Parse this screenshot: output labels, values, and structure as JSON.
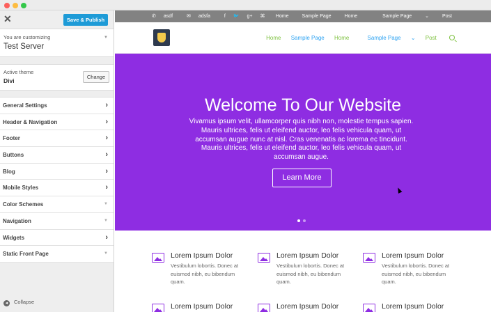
{
  "customizer": {
    "close_icon": "close-icon",
    "publish_label": "Save & Publish",
    "customizing_label": "You are customizing",
    "site_name": "Test Server",
    "active_theme_label": "Active theme",
    "theme_name": "Divi",
    "change_label": "Change",
    "sections": [
      {
        "label": "General Settings",
        "icon": "chevron-right-icon"
      },
      {
        "label": "Header & Navigation",
        "icon": "chevron-right-icon"
      },
      {
        "label": "Footer",
        "icon": "chevron-right-icon"
      },
      {
        "label": "Buttons",
        "icon": "chevron-right-icon"
      },
      {
        "label": "Blog",
        "icon": "chevron-right-icon"
      },
      {
        "label": "Mobile Styles",
        "icon": "chevron-right-icon"
      },
      {
        "label": "Color Schemes",
        "icon": "caret-down-icon"
      },
      {
        "label": "Navigation",
        "icon": "caret-down-icon"
      },
      {
        "label": "Widgets",
        "icon": "chevron-right-icon"
      },
      {
        "label": "Static Front Page",
        "icon": "caret-down-icon"
      }
    ],
    "collapse_label": "Collapse"
  },
  "site": {
    "topbar": {
      "phone": "asdf",
      "email": "adsfa",
      "social_icons": [
        "facebook-icon",
        "twitter-icon",
        "google-plus-icon",
        "rss-icon"
      ],
      "links": [
        "Home",
        "Sample Page",
        "Home",
        "Sample Page",
        "Post"
      ]
    },
    "nav": [
      "Home",
      "Sample Page",
      "Home",
      "Sample Page",
      "Post"
    ],
    "hero": {
      "title": "Welcome To Our Website",
      "text": "Vivamus ipsum velit, ullamcorper quis nibh non, molestie tempus sapien. Mauris ultrices, felis ut eleifend auctor, leo felis vehicula quam, ut accumsan augue nunc at nisl. Cras venenatis ac lorema ec tincidunt. Mauris ultrices, felis ut eleifend auctor, leo felis vehicula quam, ut accumsan augue.",
      "button": "Learn More",
      "background": "#8e2de2"
    },
    "features": [
      {
        "title": "Lorem Ipsum Dolor",
        "text": "Vestibulum lobortis. Donec at euismod nibh, eu bibendum quam."
      },
      {
        "title": "Lorem Ipsum Dolor",
        "text": "Vestibulum lobortis. Donec at euismod nibh, eu bibendum quam."
      },
      {
        "title": "Lorem Ipsum Dolor",
        "text": "Vestibulum lobortis. Donec at euismod nibh, eu bibendum quam."
      },
      {
        "title": "Lorem Ipsum Dolor",
        "text": ""
      },
      {
        "title": "Lorem Ipsum Dolor",
        "text": ""
      },
      {
        "title": "Lorem Ipsum Dolor",
        "text": ""
      }
    ]
  }
}
